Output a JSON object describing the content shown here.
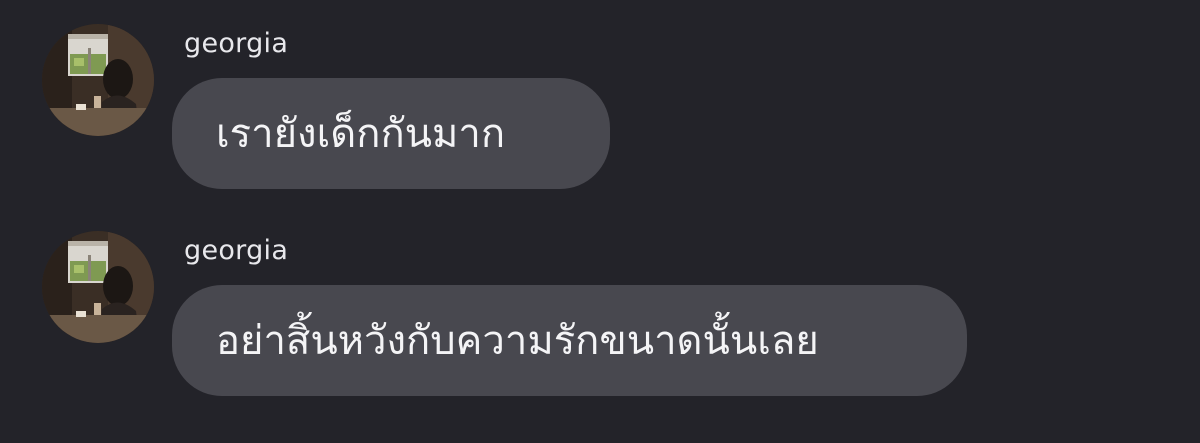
{
  "messages": [
    {
      "sender": "georgia",
      "text": "เรายังเด็กกันมาก",
      "avatar_icon": "profile-photo"
    },
    {
      "sender": "georgia",
      "text": "อย่าสิ้นหวังกับความรักขนาดนั้นเลย",
      "avatar_icon": "profile-photo"
    }
  ],
  "colors": {
    "background": "#232329",
    "bubble": "#48484f",
    "text": "#f4f4f6"
  }
}
